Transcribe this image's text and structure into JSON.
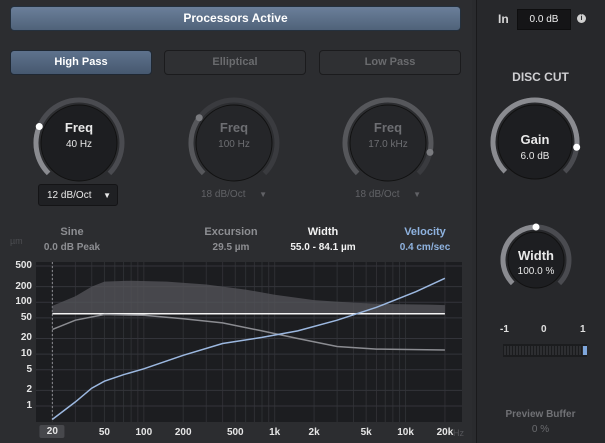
{
  "header": {
    "processors_label": "Processors Active"
  },
  "filters": {
    "high_pass": {
      "label": "High Pass",
      "knob_label": "Freq",
      "knob_value": "40 Hz",
      "slope": "12 dB/Oct",
      "active": true,
      "level": 0.25
    },
    "elliptical": {
      "label": "Elliptical",
      "knob_label": "Freq",
      "knob_value": "100 Hz",
      "slope": "18 dB/Oct",
      "active": false,
      "level": 0.3
    },
    "low_pass": {
      "label": "Low Pass",
      "knob_label": "Freq",
      "knob_value": "17.0 kHz",
      "slope": "18 dB/Oct",
      "active": false,
      "level": 0.88
    }
  },
  "stats": {
    "sine": {
      "label": "Sine",
      "value": "0.0 dB Peak"
    },
    "excursion": {
      "label": "Excursion",
      "value": "29.5 µm"
    },
    "width": {
      "label": "Width",
      "value": "55.0 - 84.1 µm"
    },
    "velocity": {
      "label": "Velocity",
      "value": "0.4 cm/sec"
    }
  },
  "graph": {
    "y_unit": "µm",
    "y_ticks": [
      "500",
      "200",
      "100",
      "50",
      "20",
      "10",
      "5",
      "2",
      "1"
    ],
    "x_ticks": [
      "20",
      "50",
      "100",
      "200",
      "500",
      "1k",
      "2k",
      "5k",
      "10k",
      "20k"
    ],
    "x_unit": "Hz"
  },
  "sidebar": {
    "in_label": "In",
    "in_value": "0.0 dB",
    "info_icon": "i",
    "disc_cut_title": "DISC CUT",
    "gain": {
      "label": "Gain",
      "value": "6.0 dB",
      "level": 0.86
    },
    "width": {
      "label": "Width",
      "value": "100.0 %",
      "level": 0.5
    },
    "meter_labels": [
      "-1",
      "0",
      "1"
    ],
    "meter_value": 1,
    "preview_label": "Preview Buffer",
    "preview_value": "0 %"
  },
  "colors": {
    "accent": "#8fb3e0",
    "active_button": "#5e728d",
    "curve_blue": "#9cb8e0"
  }
}
